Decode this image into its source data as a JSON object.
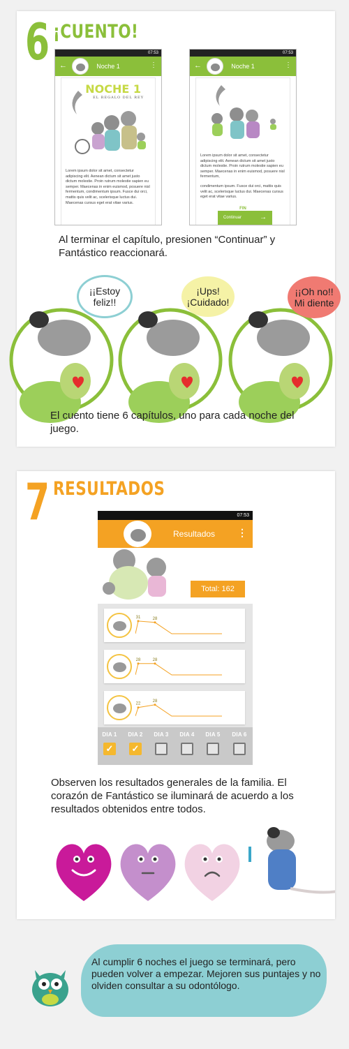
{
  "step6": {
    "number": "6",
    "title": "¡CUENTO!",
    "phone_left": {
      "time": "07:53",
      "appbar_title": "Noche 1",
      "chapter_title": "NOCHE 1",
      "chapter_subtitle": "EL REGALO DEL REY",
      "body": "Lorem ipsum dolor sit amet, consectetur adipiscing elit. Aenean dictum sit amet justo dictum molestie. Proin rutrum molestie sapien eu semper. Maecenas in enim euismod, posuere nisl fermentum, condimentum ipsum. Fusce dui orci, mattis quis velit ac, scelerisque luctus dui. Maecenas cursus eget erat vitae varius."
    },
    "phone_right": {
      "time": "07:53",
      "appbar_title": "Noche 1",
      "body1": "Lorem ipsum dolor sit amet, consectetur adipiscing elit. Aenean dictum sit amet justo dictum molestie. Proin rutrum molestie sapien eu semper. Maecenas in enim euismod, posuere nisl fermentum,",
      "body2": "condimentum ipsum. Fusce dui orci, mattis quis velit ac, scelerisque luctus dui. Maecenas cursus eget erat vitae varius.",
      "fin": "FIN",
      "continue_label": "Continuar",
      "continue_arrow": "→"
    },
    "caption1": "Al terminar el capítulo, presionen “Continuar” y Fantástico reaccionará.",
    "bubbles": [
      "¡¡Estoy feliz!!",
      "¡Ups! ¡Cuidado!",
      "¡¡Oh no!! Mi diente"
    ],
    "caption2": "El cuento tiene 6 capítulos, uno para cada noche del juego."
  },
  "step7": {
    "number": "7",
    "title": "RESULTADOS",
    "phone": {
      "time": "07:53",
      "appbar_title": "Resultados",
      "menu_icon": "⋮",
      "total_label": "Total: 162",
      "rows": [
        {
          "values": [
            31,
            28
          ],
          "labels": [
            "31",
            "28"
          ]
        },
        {
          "values": [
            28,
            28
          ],
          "labels": [
            "28",
            "28"
          ]
        },
        {
          "values": [
            22,
            28
          ],
          "labels": [
            "22",
            "28"
          ]
        }
      ],
      "days": [
        {
          "label": "DIA 1",
          "checked": true
        },
        {
          "label": "DIA 2",
          "checked": true
        },
        {
          "label": "DIA 3",
          "checked": false
        },
        {
          "label": "DIA 4",
          "checked": false
        },
        {
          "label": "DIA 5",
          "checked": false
        },
        {
          "label": "DIA 6",
          "checked": false
        }
      ]
    },
    "caption": "Observen los resultados generales de la familia. El corazón de Fantástico se iluminará de acuerdo a los resultados obtenidos entre todos.",
    "hearts": [
      {
        "mood": "happy",
        "color": "#c91a9a"
      },
      {
        "mood": "neutral",
        "color": "#c48fcc"
      },
      {
        "mood": "sad",
        "color": "#f2d2e3"
      }
    ]
  },
  "final_note": "Al cumplir 6 noches el juego se terminará, pero pueden volver a empezar. Mejoren sus puntajes y no olviden consultar a su odontólogo.",
  "colors": {
    "green": "#8bbf3a",
    "orange": "#f4a223",
    "bubble_blue": "#8dcfd3"
  }
}
